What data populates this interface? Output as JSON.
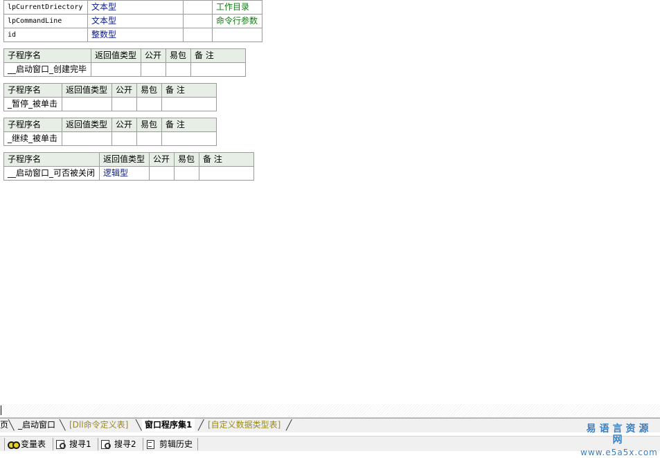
{
  "params": [
    {
      "name": "lpCurrentDriectory",
      "type": "文本型",
      "ref": "",
      "note": "工作目录"
    },
    {
      "name": "lpCommandLine",
      "type": "文本型",
      "ref": "",
      "note": "命令行参数"
    },
    {
      "name": "id",
      "type": "整数型",
      "ref": "",
      "note": ""
    }
  ],
  "subs_header": {
    "name": "子程序名",
    "return_type": "返回值类型",
    "public": "公开",
    "easy_pkg": "易包",
    "note": "备 注"
  },
  "subs": [
    {
      "name": "__启动窗口_创建完毕",
      "return_type": "",
      "public": "",
      "easy_pkg": "",
      "note": ""
    },
    {
      "name": "_暂停_被单击",
      "return_type": "",
      "public": "",
      "easy_pkg": "",
      "note": ""
    },
    {
      "name": "_继续_被单击",
      "return_type": "",
      "public": "",
      "easy_pkg": "",
      "note": ""
    },
    {
      "name": "__启动窗口_可否被关闭",
      "return_type": "逻辑型",
      "public": "",
      "easy_pkg": "",
      "note": ""
    }
  ],
  "tabs": [
    {
      "label": "页"
    },
    {
      "label": "_启动窗口"
    },
    {
      "label": "[Dll命令定义表]"
    },
    {
      "label": "窗口程序集1"
    },
    {
      "label": "[自定义数据类型表]"
    }
  ],
  "bottom_buttons": [
    {
      "label": "变量表",
      "icon": "variable-table-icon"
    },
    {
      "label": "搜寻1",
      "icon": "search-icon"
    },
    {
      "label": "搜寻2",
      "icon": "search-icon"
    },
    {
      "label": "剪辑历史",
      "icon": "clip-history-icon"
    }
  ],
  "watermark": {
    "title": "易语言资源网",
    "url": "www.e5a5x.com"
  },
  "colors": {
    "type_text": "#0a1a8c",
    "note_text": "#107a10",
    "header_bg": "#e6eee6",
    "tab_gold": "#9a8a1a"
  }
}
